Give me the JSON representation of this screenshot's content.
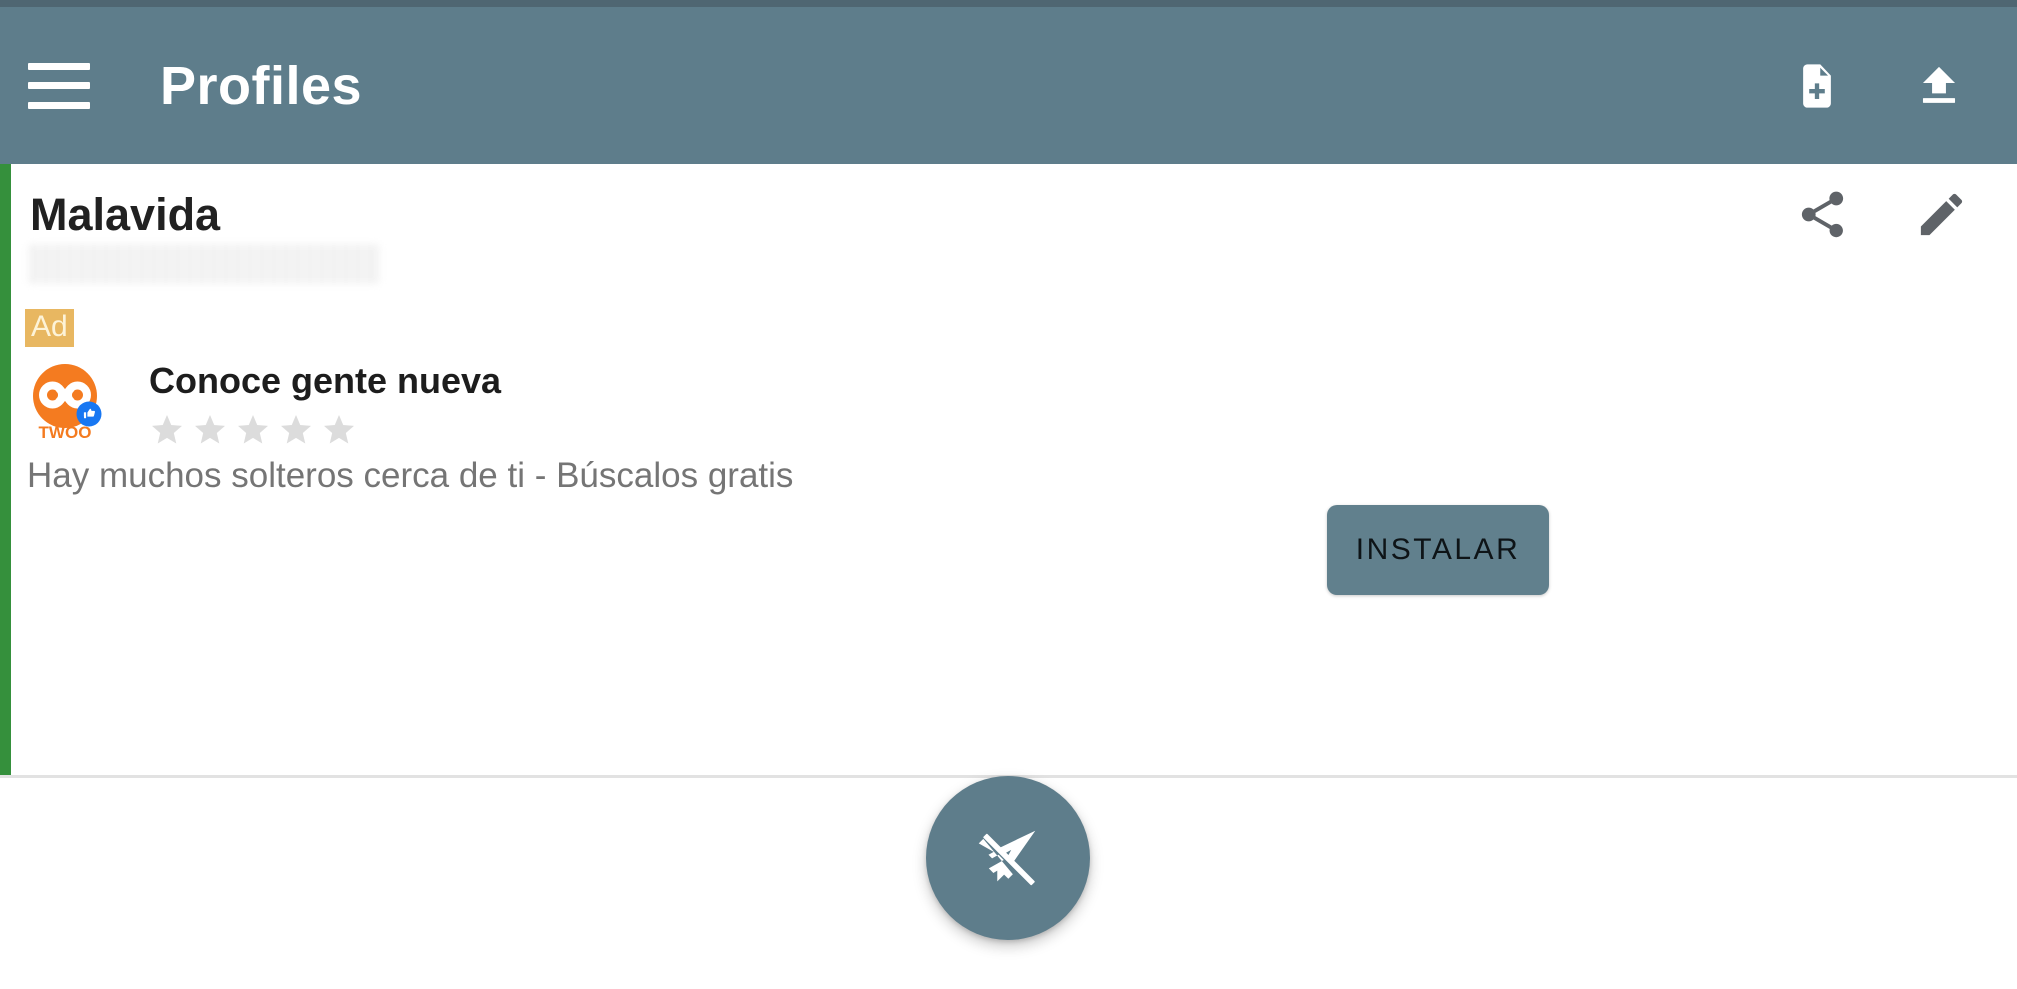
{
  "status_bar": {
    "color": "#4f6672"
  },
  "app_bar": {
    "title": "Profiles",
    "background_color": "#5e7d8b",
    "menu_icon": "hamburger-menu-icon",
    "actions": [
      {
        "name": "new-file-icon",
        "label": "New file"
      },
      {
        "name": "upload-icon",
        "label": "Upload"
      }
    ]
  },
  "card": {
    "accent_color": "#35903c",
    "title": "Malavida",
    "subtitle_redacted": "",
    "actions": [
      {
        "name": "share-icon",
        "label": "Share"
      },
      {
        "name": "edit-icon",
        "label": "Edit"
      }
    ]
  },
  "ad": {
    "badge_label": "Ad",
    "badge_color": "#e8b761",
    "app_icon_name": "twoo-app-icon",
    "app_icon_brand": "TWOO",
    "app_icon_color": "#f47b20",
    "verified_badge": "thumbs-up-badge",
    "title": "Conoce gente nueva",
    "rating_stars_total": 5,
    "rating_stars_filled": 0,
    "star_color": "#dcdcdc",
    "description": "Hay muchos solteros cerca de ti - Búscalos gratis",
    "install_label": "INSTALAR",
    "install_color": "#61808d"
  },
  "fab": {
    "icon_name": "send-off-icon",
    "color": "#5e7d8b"
  }
}
